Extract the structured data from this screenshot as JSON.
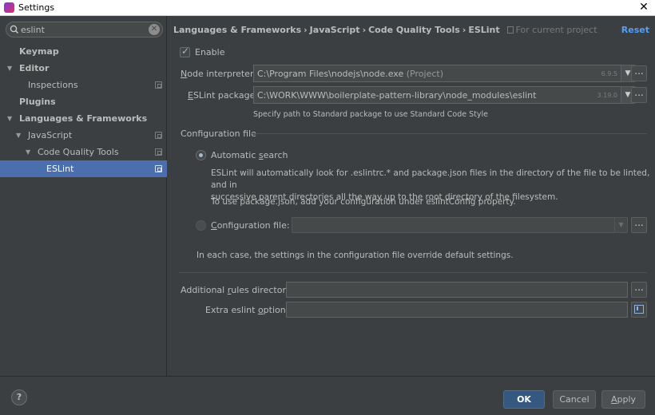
{
  "window": {
    "title": "Settings",
    "close_glyph": "✕"
  },
  "sidebar": {
    "search": {
      "value": "eslint",
      "clear_glyph": "✕"
    },
    "items": [
      {
        "label": "Keymap"
      },
      {
        "label": "Editor"
      },
      {
        "label": "Inspections"
      },
      {
        "label": "Plugins"
      },
      {
        "label": "Languages & Frameworks"
      },
      {
        "label": "JavaScript"
      },
      {
        "label": "Code Quality Tools"
      },
      {
        "label": "ESLint"
      }
    ]
  },
  "main": {
    "breadcrumb": [
      "Languages & Frameworks",
      "JavaScript",
      "Code Quality Tools",
      "ESLint"
    ],
    "breadcrumb_sep": "›",
    "scope_label": "For current project",
    "reset_label": "Reset",
    "enable": {
      "label": "Enable",
      "checked": true
    },
    "node_interpreter": {
      "label_prefix": "N",
      "label_rest": "ode interpreter:",
      "path": "C:\\Program Files\\nodejs\\node.exe",
      "suffix": "(Project)",
      "version": "6.9.5"
    },
    "eslint_package": {
      "label_prefix": "E",
      "label_rest": "SLint package:",
      "path": "C:\\WORK\\WWW\\boilerplate-pattern-library\\node_modules\\eslint",
      "version": "3.19.0",
      "hint": "Specify path to Standard package to use Standard Code Style"
    },
    "config_section": {
      "title": "Configuration file",
      "automatic": {
        "label_prefix": "Automatic ",
        "label_u": "s",
        "label_rest": "earch",
        "selected": true
      },
      "desc1_line1": "ESLint will automatically look for .eslintrc.* and package.json files in the directory of the file to be linted, and in",
      "desc1_line2": "successive parent directories all the way up to the root directory of the filesystem.",
      "desc2": "To use package.json, add your configuration under eslintConfig property.",
      "config_file": {
        "label_prefix": "C",
        "label_rest": "onfiguration file:",
        "selected": false
      },
      "override_note": "In each case, the settings in the configuration file override default settings."
    },
    "additional_rules": {
      "label_prefix": "Additional ",
      "label_u": "r",
      "label_rest": "ules directory:"
    },
    "extra_options": {
      "label_prefix": "Extra eslint ",
      "label_u": "o",
      "label_rest": "ptions:"
    },
    "dots_glyph": "...",
    "dropdown_glyph": "▼"
  },
  "footer": {
    "help_glyph": "?",
    "ok_label": "OK",
    "cancel_label": "Cancel",
    "apply_label": "Apply",
    "apply_u": "A",
    "apply_rest": "pply"
  },
  "icons": {
    "app": "intellij-app-icon",
    "search": "search-icon",
    "clear": "clear-icon",
    "tree_expanded": "chevron-down-icon",
    "project": "project-scope-icon",
    "folder": "folder-icon",
    "help": "help-icon"
  },
  "colors": {
    "accent": "#4b6eaf",
    "link": "#589df6",
    "default_button": "#365880",
    "background": "#3c3f41"
  }
}
